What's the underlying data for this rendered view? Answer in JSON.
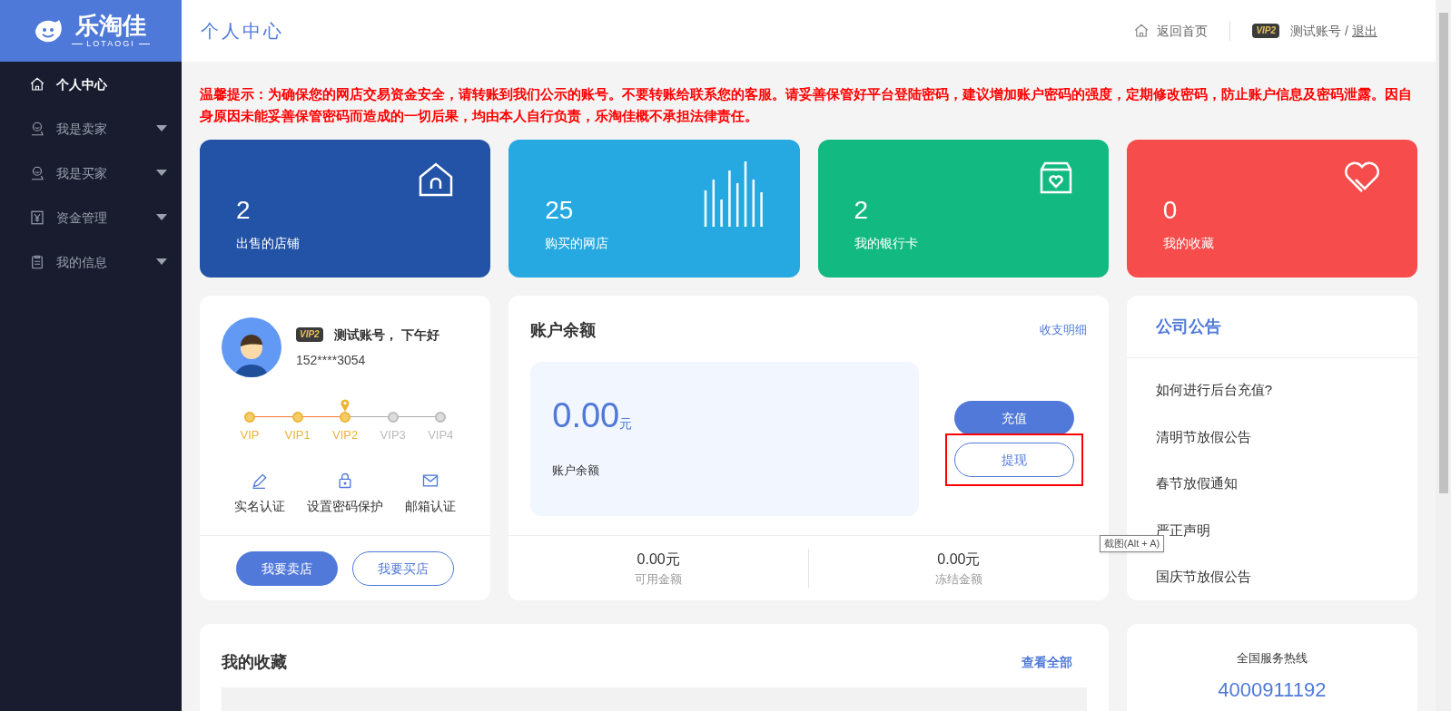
{
  "logo": {
    "name": "乐淘佳",
    "subtitle": "LOTAOGI"
  },
  "header": {
    "title": "个人中心",
    "home_link": "返回首页",
    "vip_badge": "VIP2",
    "account": "测试账号",
    "separator": "/",
    "logout": "退出"
  },
  "sidebar": {
    "items": [
      {
        "label": "个人中心",
        "kind": "home",
        "selected": true,
        "expandable": false
      },
      {
        "label": "我是卖家",
        "kind": "person",
        "selected": false,
        "expandable": true
      },
      {
        "label": "我是买家",
        "kind": "person",
        "selected": false,
        "expandable": true
      },
      {
        "label": "资金管理",
        "kind": "yen",
        "selected": false,
        "expandable": true
      },
      {
        "label": "我的信息",
        "kind": "clipboard",
        "selected": false,
        "expandable": true
      }
    ]
  },
  "notice": "温馨提示：为确保您的网店交易资金安全，请转账到我们公示的账号。不要转账给联系您的客服。请妥善保管好平台登陆密码，建议增加账户密码的强度，定期修改密码，防止账户信息及密码泄露。因自身原因未能妥善保管密码而造成的一切后果，均由本人自行负责，乐淘佳概不承担法律责任。",
  "stats": [
    {
      "value": "2",
      "label": "出售的店铺",
      "color": "#2253a6",
      "kind": "house"
    },
    {
      "value": "25",
      "label": "购买的网店",
      "color": "#26a9e1",
      "kind": "bars"
    },
    {
      "value": "2",
      "label": "我的银行卡",
      "color": "#12b981",
      "kind": "box"
    },
    {
      "value": "0",
      "label": "我的收藏",
      "color": "#f64c4c",
      "kind": "heart"
    }
  ],
  "profile": {
    "vip_badge": "VIP2",
    "greeting": "测试账号，  下午好",
    "phone": "152****3054",
    "levels": [
      {
        "label": "VIP",
        "reached": true,
        "selected": false
      },
      {
        "label": "VIP1",
        "reached": true,
        "selected": false
      },
      {
        "label": "VIP2",
        "reached": true,
        "selected": true
      },
      {
        "label": "VIP3",
        "reached": false,
        "selected": false
      },
      {
        "label": "VIP4",
        "reached": false,
        "selected": false
      }
    ],
    "verifications": [
      {
        "label": "实名认证",
        "kind": "pencil"
      },
      {
        "label": "设置密码保护",
        "kind": "lock"
      },
      {
        "label": "邮箱认证",
        "kind": "mail"
      }
    ],
    "buttons": [
      {
        "label": "我要卖店",
        "kind": "primary"
      },
      {
        "label": "我要买店",
        "kind": "outline"
      }
    ]
  },
  "balance": {
    "title": "账户余额",
    "details_link": "收支明细",
    "amount": "0.00",
    "unit": "元",
    "amount_label": "账户余额",
    "buttons": [
      {
        "label": "充值",
        "kind": "primary",
        "highlighted": false
      },
      {
        "label": "提现",
        "kind": "outline",
        "highlighted": true
      }
    ],
    "summary": [
      {
        "value": "0.00元",
        "label": "可用金额"
      },
      {
        "value": "0.00元",
        "label": "冻结金额"
      }
    ]
  },
  "tooltip": "截图(Alt + A)",
  "announcements": {
    "title": "公司公告",
    "items": [
      "如何进行后台充值?",
      "清明节放假公告",
      "春节放假通知",
      "严正声明",
      "国庆节放假公告"
    ]
  },
  "favorites": {
    "title": "我的收藏",
    "view_all": "查看全部"
  },
  "hotline": {
    "label": "全国服务热线",
    "number": "4000911192"
  }
}
